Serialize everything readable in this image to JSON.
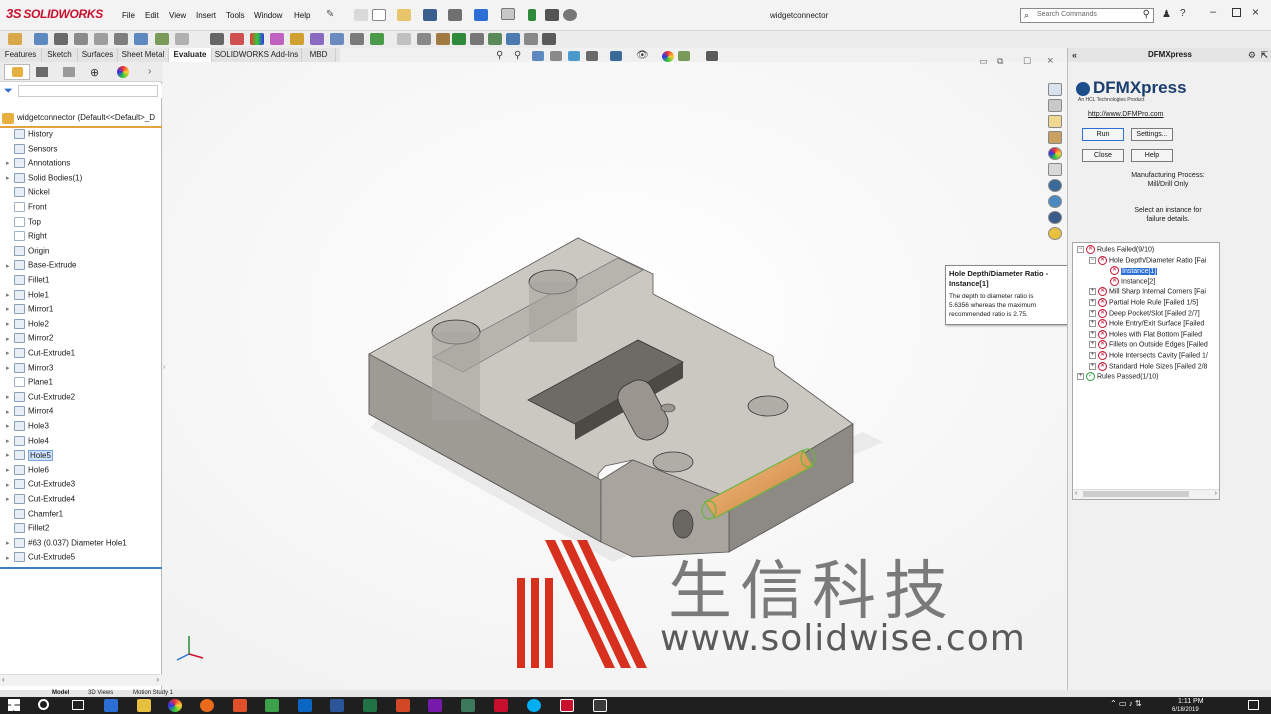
{
  "app": {
    "name": "SOLIDWORKS",
    "document_title": "widgetconnector"
  },
  "menu": [
    "File",
    "Edit",
    "View",
    "Insert",
    "Tools",
    "Window",
    "Help"
  ],
  "search": {
    "placeholder": "Search Commands"
  },
  "tabs": [
    {
      "label": "Features",
      "active": false
    },
    {
      "label": "Sketch",
      "active": false
    },
    {
      "label": "Surfaces",
      "active": false
    },
    {
      "label": "Sheet Metal",
      "active": false
    },
    {
      "label": "Evaluate",
      "active": true
    },
    {
      "label": "SOLIDWORKS Add-Ins",
      "active": false
    },
    {
      "label": "MBD",
      "active": false
    }
  ],
  "feature_tree": {
    "root": "widgetconnector  (Default<<Default>_D",
    "items": [
      {
        "label": "History",
        "expandable": false,
        "selected": false
      },
      {
        "label": "Sensors",
        "expandable": false,
        "selected": false
      },
      {
        "label": "Annotations",
        "expandable": true,
        "selected": false
      },
      {
        "label": "Solid Bodies(1)",
        "expandable": true,
        "selected": false
      },
      {
        "label": "Nickel",
        "expandable": false,
        "selected": false
      },
      {
        "label": "Front",
        "expandable": false,
        "selected": false
      },
      {
        "label": "Top",
        "expandable": false,
        "selected": false
      },
      {
        "label": "Right",
        "expandable": false,
        "selected": false
      },
      {
        "label": "Origin",
        "expandable": false,
        "selected": false
      },
      {
        "label": "Base-Extrude",
        "expandable": true,
        "selected": false
      },
      {
        "label": "Fillet1",
        "expandable": false,
        "selected": false
      },
      {
        "label": "Hole1",
        "expandable": true,
        "selected": false
      },
      {
        "label": "Mirror1",
        "expandable": true,
        "selected": false
      },
      {
        "label": "Hole2",
        "expandable": true,
        "selected": false
      },
      {
        "label": "Mirror2",
        "expandable": true,
        "selected": false
      },
      {
        "label": "Cut-Extrude1",
        "expandable": true,
        "selected": false
      },
      {
        "label": "Mirror3",
        "expandable": true,
        "selected": false
      },
      {
        "label": "Plane1",
        "expandable": false,
        "selected": false
      },
      {
        "label": "Cut-Extrude2",
        "expandable": true,
        "selected": false
      },
      {
        "label": "Mirror4",
        "expandable": true,
        "selected": false
      },
      {
        "label": "Hole3",
        "expandable": true,
        "selected": false
      },
      {
        "label": "Hole4",
        "expandable": true,
        "selected": false
      },
      {
        "label": "Hole5",
        "expandable": true,
        "selected": true
      },
      {
        "label": "Hole6",
        "expandable": true,
        "selected": false
      },
      {
        "label": "Cut-Extrude3",
        "expandable": true,
        "selected": false
      },
      {
        "label": "Cut-Extrude4",
        "expandable": true,
        "selected": false
      },
      {
        "label": "Chamfer1",
        "expandable": false,
        "selected": false
      },
      {
        "label": "Fillet2",
        "expandable": false,
        "selected": false
      },
      {
        "label": "#63 (0.037) Diameter Hole1",
        "expandable": true,
        "selected": false
      },
      {
        "label": "Cut-Extrude5",
        "expandable": true,
        "selected": false
      }
    ]
  },
  "dfmxpress": {
    "panel_title": "DFMXpress",
    "logo": "DFMXpress",
    "tagline": "An HCL Technologies Product",
    "link": "http://www.DFMPro.com",
    "buttons": {
      "run": "Run",
      "settings": "Settings...",
      "close": "Close",
      "help": "Help"
    },
    "process_label": "Manufacturing Process:",
    "process_value": "Mill/Drill Only",
    "instruction_1": "Select an instance for",
    "instruction_2": "failure details.",
    "rules": [
      {
        "label": "Rules Failed(9/10)",
        "level": 0,
        "status": "fail",
        "toggle": "-"
      },
      {
        "label": "Hole Depth/Diameter Ratio [Fai",
        "level": 1,
        "status": "fail",
        "toggle": "-"
      },
      {
        "label": "Instance[1]",
        "level": 2,
        "status": "fail",
        "toggle": "",
        "selected": true
      },
      {
        "label": "Instance[2]",
        "level": 2,
        "status": "fail",
        "toggle": ""
      },
      {
        "label": "Mill Sharp Internal Corners [Fai",
        "level": 1,
        "status": "fail",
        "toggle": "+"
      },
      {
        "label": "Partial Hole Rule [Failed 1/5]",
        "level": 1,
        "status": "fail",
        "toggle": "+"
      },
      {
        "label": "Deep Pocket/Slot [Failed 2/7]",
        "level": 1,
        "status": "fail",
        "toggle": "+"
      },
      {
        "label": "Hole Entry/Exit Surface [Failed",
        "level": 1,
        "status": "fail",
        "toggle": "+"
      },
      {
        "label": "Holes with Flat Bottom [Failed",
        "level": 1,
        "status": "fail",
        "toggle": "+"
      },
      {
        "label": "Fillets on Outside Edges [Failed",
        "level": 1,
        "status": "fail",
        "toggle": "+"
      },
      {
        "label": "Hole Intersects Cavity [Failed 1/",
        "level": 1,
        "status": "fail",
        "toggle": "+"
      },
      {
        "label": "Standard Hole Sizes [Failed 2/8",
        "level": 1,
        "status": "fail",
        "toggle": "+"
      },
      {
        "label": "Rules Passed(1/10)",
        "level": 0,
        "status": "pass",
        "toggle": "+"
      }
    ]
  },
  "tooltip": {
    "title": "Hole Depth/Diameter Ratio -",
    "subtitle": "Instance[1]",
    "line1": "The depth to diameter ratio is",
    "line2": "5.6356 whereas the maximum",
    "line3": "recommended ratio is 2.75."
  },
  "watermark": {
    "chinese": "生信科技",
    "url": "www.solidwise.com"
  },
  "bottom_tabs": [
    "Model",
    "3D Views",
    "Motion Study 1"
  ],
  "clock": {
    "time": "1:11 PM",
    "date": "6/18/2019"
  },
  "colors": {
    "solidworks_red": "#c8102e",
    "selection_blue": "#2b6fd6",
    "fail_red": "#c8102e",
    "pass_green": "#2d9a3a",
    "part_gray": "#a9a59e"
  }
}
